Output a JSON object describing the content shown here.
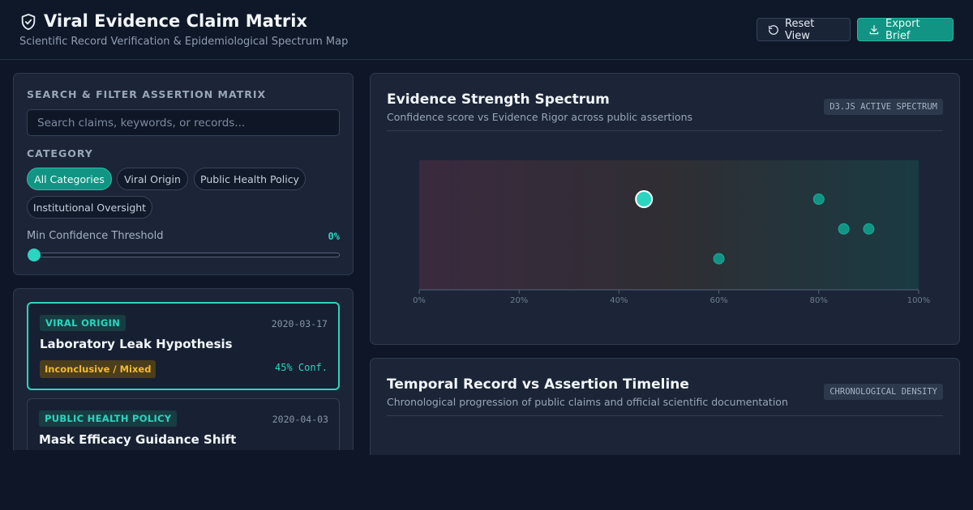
{
  "header": {
    "title": "Viral Evidence Claim Matrix",
    "subtitle": "Scientific Record Verification & Epidemiological Spectrum Map",
    "reset_label": "Reset View",
    "export_label": "Export Brief"
  },
  "filters": {
    "section_title": "SEARCH & FILTER ASSERTION MATRIX",
    "search_placeholder": "Search claims, keywords, or records...",
    "category_label": "CATEGORY",
    "categories": [
      {
        "label": "All Categories",
        "active": true
      },
      {
        "label": "Viral Origin",
        "active": false
      },
      {
        "label": "Public Health Policy",
        "active": false
      },
      {
        "label": "Institutional Oversight",
        "active": false
      }
    ],
    "threshold_label": "Min Confidence Threshold",
    "threshold_value": "0%",
    "threshold_fraction": 0
  },
  "claims": [
    {
      "tag": "VIRAL ORIGIN",
      "date": "2020-03-17",
      "title": "Laboratory Leak Hypothesis",
      "verdict": "Inconclusive / Mixed",
      "confidence": "45% Conf.",
      "selected": true
    },
    {
      "tag": "PUBLIC HEALTH POLICY",
      "date": "2020-04-03",
      "title": "Mask Efficacy Guidance Shift",
      "selected": false
    }
  ],
  "spectrum": {
    "title": "Evidence Strength Spectrum",
    "subtitle": "Confidence score vs Evidence Rigor across public assertions",
    "badge": "D3.JS ACTIVE SPECTRUM"
  },
  "timeline": {
    "title": "Temporal Record vs Assertion Timeline",
    "subtitle": "Chronological progression of public claims and official scientific documentation",
    "badge": "CHRONOLOGICAL DENSITY"
  },
  "colors": {
    "accent": "#2dd4bf",
    "accent_dark": "#119484",
    "warning": "#f5b92e",
    "background": "#0e1627",
    "panel": "#1b2537"
  },
  "chart_data": {
    "type": "scatter",
    "title": "Evidence Strength Spectrum",
    "x_ticks": [
      "0%",
      "20%",
      "40%",
      "60%",
      "80%",
      "100%"
    ],
    "xlim": [
      0,
      100
    ],
    "ylim": [
      0,
      1
    ],
    "grid": false,
    "points": [
      {
        "x": 45,
        "y": 0.7,
        "selected": true
      },
      {
        "x": 80,
        "y": 0.7,
        "selected": false
      },
      {
        "x": 85,
        "y": 0.47,
        "selected": false
      },
      {
        "x": 90,
        "y": 0.47,
        "selected": false
      },
      {
        "x": 60,
        "y": 0.24,
        "selected": false
      }
    ]
  }
}
